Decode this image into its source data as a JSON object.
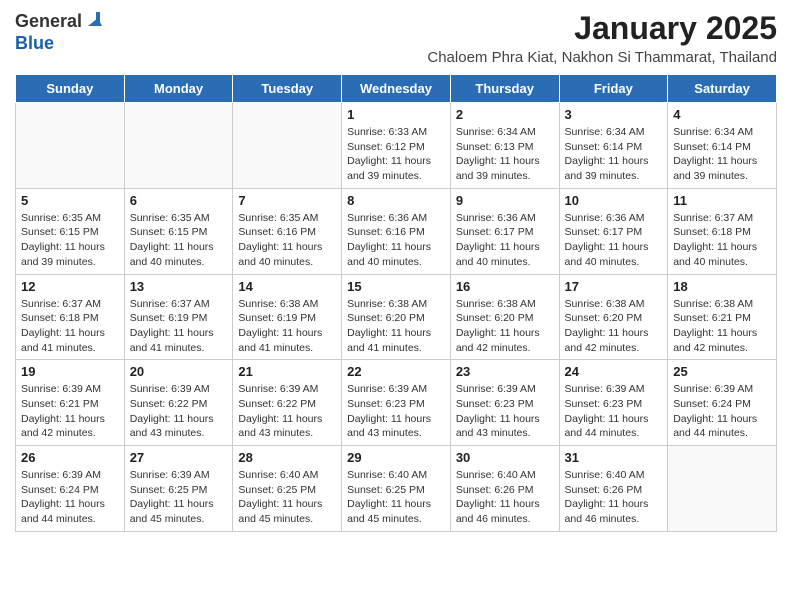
{
  "logo": {
    "general": "General",
    "blue": "Blue"
  },
  "header": {
    "title": "January 2025",
    "subtitle": "Chaloem Phra Kiat, Nakhon Si Thammarat, Thailand"
  },
  "columns": [
    "Sunday",
    "Monday",
    "Tuesday",
    "Wednesday",
    "Thursday",
    "Friday",
    "Saturday"
  ],
  "weeks": [
    [
      {
        "day": "",
        "info": ""
      },
      {
        "day": "",
        "info": ""
      },
      {
        "day": "",
        "info": ""
      },
      {
        "day": "1",
        "info": "Sunrise: 6:33 AM\nSunset: 6:12 PM\nDaylight: 11 hours and 39 minutes."
      },
      {
        "day": "2",
        "info": "Sunrise: 6:34 AM\nSunset: 6:13 PM\nDaylight: 11 hours and 39 minutes."
      },
      {
        "day": "3",
        "info": "Sunrise: 6:34 AM\nSunset: 6:14 PM\nDaylight: 11 hours and 39 minutes."
      },
      {
        "day": "4",
        "info": "Sunrise: 6:34 AM\nSunset: 6:14 PM\nDaylight: 11 hours and 39 minutes."
      }
    ],
    [
      {
        "day": "5",
        "info": "Sunrise: 6:35 AM\nSunset: 6:15 PM\nDaylight: 11 hours and 39 minutes."
      },
      {
        "day": "6",
        "info": "Sunrise: 6:35 AM\nSunset: 6:15 PM\nDaylight: 11 hours and 40 minutes."
      },
      {
        "day": "7",
        "info": "Sunrise: 6:35 AM\nSunset: 6:16 PM\nDaylight: 11 hours and 40 minutes."
      },
      {
        "day": "8",
        "info": "Sunrise: 6:36 AM\nSunset: 6:16 PM\nDaylight: 11 hours and 40 minutes."
      },
      {
        "day": "9",
        "info": "Sunrise: 6:36 AM\nSunset: 6:17 PM\nDaylight: 11 hours and 40 minutes."
      },
      {
        "day": "10",
        "info": "Sunrise: 6:36 AM\nSunset: 6:17 PM\nDaylight: 11 hours and 40 minutes."
      },
      {
        "day": "11",
        "info": "Sunrise: 6:37 AM\nSunset: 6:18 PM\nDaylight: 11 hours and 40 minutes."
      }
    ],
    [
      {
        "day": "12",
        "info": "Sunrise: 6:37 AM\nSunset: 6:18 PM\nDaylight: 11 hours and 41 minutes."
      },
      {
        "day": "13",
        "info": "Sunrise: 6:37 AM\nSunset: 6:19 PM\nDaylight: 11 hours and 41 minutes."
      },
      {
        "day": "14",
        "info": "Sunrise: 6:38 AM\nSunset: 6:19 PM\nDaylight: 11 hours and 41 minutes."
      },
      {
        "day": "15",
        "info": "Sunrise: 6:38 AM\nSunset: 6:20 PM\nDaylight: 11 hours and 41 minutes."
      },
      {
        "day": "16",
        "info": "Sunrise: 6:38 AM\nSunset: 6:20 PM\nDaylight: 11 hours and 42 minutes."
      },
      {
        "day": "17",
        "info": "Sunrise: 6:38 AM\nSunset: 6:20 PM\nDaylight: 11 hours and 42 minutes."
      },
      {
        "day": "18",
        "info": "Sunrise: 6:38 AM\nSunset: 6:21 PM\nDaylight: 11 hours and 42 minutes."
      }
    ],
    [
      {
        "day": "19",
        "info": "Sunrise: 6:39 AM\nSunset: 6:21 PM\nDaylight: 11 hours and 42 minutes."
      },
      {
        "day": "20",
        "info": "Sunrise: 6:39 AM\nSunset: 6:22 PM\nDaylight: 11 hours and 43 minutes."
      },
      {
        "day": "21",
        "info": "Sunrise: 6:39 AM\nSunset: 6:22 PM\nDaylight: 11 hours and 43 minutes."
      },
      {
        "day": "22",
        "info": "Sunrise: 6:39 AM\nSunset: 6:23 PM\nDaylight: 11 hours and 43 minutes."
      },
      {
        "day": "23",
        "info": "Sunrise: 6:39 AM\nSunset: 6:23 PM\nDaylight: 11 hours and 43 minutes."
      },
      {
        "day": "24",
        "info": "Sunrise: 6:39 AM\nSunset: 6:23 PM\nDaylight: 11 hours and 44 minutes."
      },
      {
        "day": "25",
        "info": "Sunrise: 6:39 AM\nSunset: 6:24 PM\nDaylight: 11 hours and 44 minutes."
      }
    ],
    [
      {
        "day": "26",
        "info": "Sunrise: 6:39 AM\nSunset: 6:24 PM\nDaylight: 11 hours and 44 minutes."
      },
      {
        "day": "27",
        "info": "Sunrise: 6:39 AM\nSunset: 6:25 PM\nDaylight: 11 hours and 45 minutes."
      },
      {
        "day": "28",
        "info": "Sunrise: 6:40 AM\nSunset: 6:25 PM\nDaylight: 11 hours and 45 minutes."
      },
      {
        "day": "29",
        "info": "Sunrise: 6:40 AM\nSunset: 6:25 PM\nDaylight: 11 hours and 45 minutes."
      },
      {
        "day": "30",
        "info": "Sunrise: 6:40 AM\nSunset: 6:26 PM\nDaylight: 11 hours and 46 minutes."
      },
      {
        "day": "31",
        "info": "Sunrise: 6:40 AM\nSunset: 6:26 PM\nDaylight: 11 hours and 46 minutes."
      },
      {
        "day": "",
        "info": ""
      }
    ]
  ]
}
